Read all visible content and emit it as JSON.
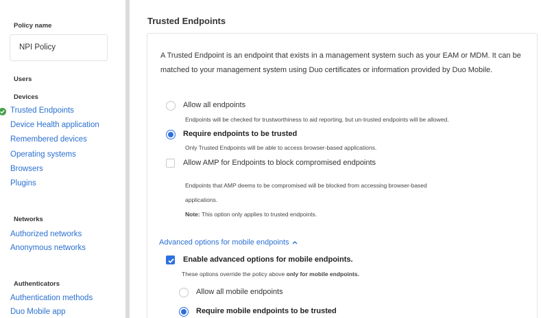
{
  "sidebar": {
    "policy_name_label": "Policy name",
    "policy_name_value": "NPI Policy",
    "users_label": "Users",
    "devices_label": "Devices",
    "device_links": [
      "Trusted Endpoints",
      "Device Health application",
      "Remembered devices",
      "Operating systems",
      "Browsers",
      "Plugins"
    ],
    "networks_label": "Networks",
    "network_links": [
      "Authorized networks",
      "Anonymous networks"
    ],
    "authenticators_label": "Authenticators",
    "authenticator_links": [
      "Authentication methods",
      "Duo Mobile app"
    ]
  },
  "main": {
    "title": "Trusted Endpoints",
    "intro": "A Trusted Endpoint is an endpoint that exists in a management system such as your EAM or MDM. It can be matched to your management system using Duo certificates or information provided by Duo Mobile.",
    "opt_allow_all": "Allow all endpoints",
    "opt_allow_all_note": "Endpoints will be checked for trustworthiness to aid reporting, but un-trusted endpoints will be allowed.",
    "opt_require": "Require endpoints to be trusted",
    "opt_require_note": "Only Trusted Endpoints will be able to access browser-based applications.",
    "opt_amp": "Allow AMP for Endpoints to block compromised endpoints",
    "amp_note_line1": "Endpoints that AMP deems to be compromised will be blocked from accessing browser-based",
    "amp_note_line2": "applications.",
    "amp_note_bold": "Note:",
    "amp_note_rest": " This option only applies to trusted endpoints.",
    "advanced_link": "Advanced options for mobile endpoints",
    "enable_advanced": "Enable advanced options for mobile endpoints.",
    "override_note_pre": "These options override the policy above ",
    "override_note_bold": "only for mobile endpoints.",
    "mobile_allow_all": "Allow all mobile endpoints",
    "mobile_require": "Require mobile endpoints to be trusted"
  },
  "colors": {
    "link": "#2a6fd0",
    "accent": "#2d6fe0",
    "success": "#43a047"
  }
}
